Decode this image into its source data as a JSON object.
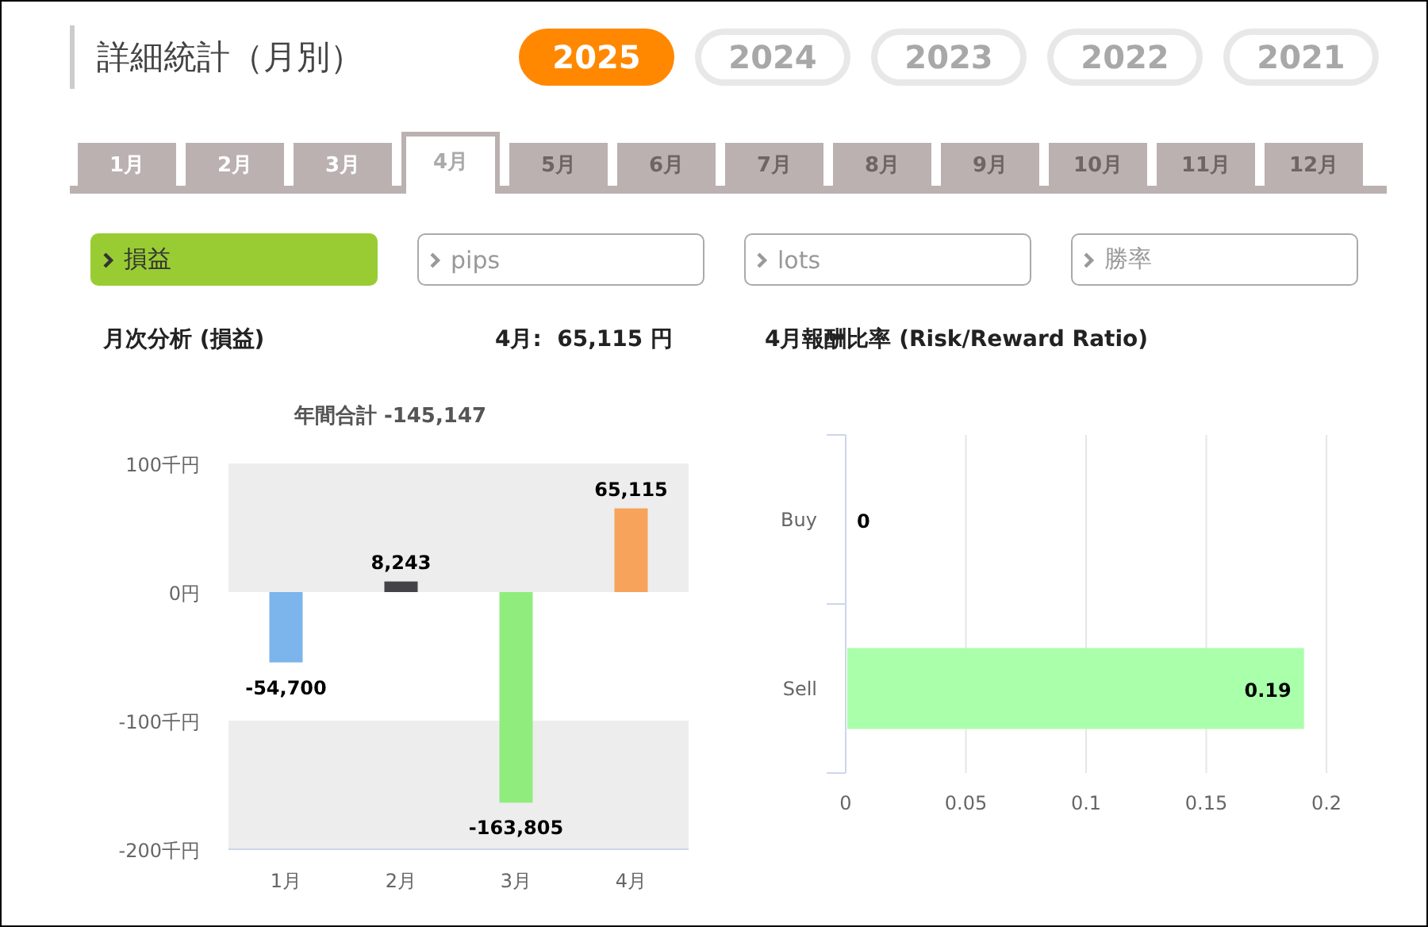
{
  "header": {
    "title": "詳細統計（月別）",
    "years": [
      {
        "label": "2025",
        "selected": true
      },
      {
        "label": "2024",
        "selected": false
      },
      {
        "label": "2023",
        "selected": false
      },
      {
        "label": "2022",
        "selected": false
      },
      {
        "label": "2021",
        "selected": false
      }
    ]
  },
  "month_tabs": [
    {
      "label": "1月",
      "selected": false,
      "disabled": false
    },
    {
      "label": "2月",
      "selected": false,
      "disabled": false
    },
    {
      "label": "3月",
      "selected": false,
      "disabled": false
    },
    {
      "label": "4月",
      "selected": true,
      "disabled": false
    },
    {
      "label": "5月",
      "selected": false,
      "disabled": true
    },
    {
      "label": "6月",
      "selected": false,
      "disabled": true
    },
    {
      "label": "7月",
      "selected": false,
      "disabled": true
    },
    {
      "label": "8月",
      "selected": false,
      "disabled": true
    },
    {
      "label": "9月",
      "selected": false,
      "disabled": true
    },
    {
      "label": "10月",
      "selected": false,
      "disabled": true
    },
    {
      "label": "11月",
      "selected": false,
      "disabled": true
    },
    {
      "label": "12月",
      "selected": false,
      "disabled": true
    }
  ],
  "metric_buttons": [
    {
      "label": "損益",
      "selected": true
    },
    {
      "label": "pips",
      "selected": false
    },
    {
      "label": "lots",
      "selected": false
    },
    {
      "label": "勝率",
      "selected": false
    }
  ],
  "headings": {
    "monthly": "月次分析 (損益)",
    "month_total": "4月:  65,115 円",
    "ratio": "4月報酬比率 (Risk/Reward Ratio)"
  },
  "monthly_chart": {
    "chart_data": {
      "type": "bar",
      "title": "年間合計 -145,147",
      "categories": [
        "1月",
        "2月",
        "3月",
        "4月"
      ],
      "series": [
        {
          "values": [
            -54.7,
            8.243,
            -163.805,
            65.115
          ],
          "colors": [
            "#7cb5ec",
            "#434348",
            "#90ed7d",
            "#f7a35c"
          ]
        }
      ],
      "ylim": [
        -200,
        100
      ],
      "yticks": [
        {
          "value": 100,
          "label": "100千円"
        },
        {
          "value": 0,
          "label": "0円"
        },
        {
          "value": -100,
          "label": "-100千円"
        },
        {
          "value": -200,
          "label": "-200千円"
        }
      ],
      "value_labels": [
        "-54,700",
        "8,243",
        "-163,805",
        "65,115"
      ]
    }
  },
  "ratio_chart": {
    "chart_data": {
      "type": "bar",
      "orientation": "horizontal",
      "categories": [
        "Buy",
        "Sell"
      ],
      "series": [
        {
          "color": "#aaffaa",
          "values": [
            0,
            0.19
          ]
        }
      ],
      "xlim": [
        0,
        0.2
      ],
      "xticks": [
        0,
        0.05,
        0.1,
        0.15,
        0.2
      ],
      "grid": true,
      "data_labels": true
    }
  }
}
